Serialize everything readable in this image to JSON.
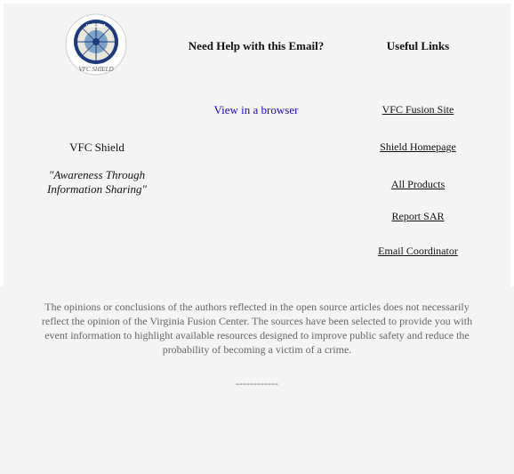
{
  "header": {
    "logo_text_top": "VIRGINIA",
    "logo_text_bottom": "VFC SHIELD",
    "logo_side_text": "FUSION CENTER",
    "help_heading": "Need Help with this Email?",
    "links_heading": "Useful Links"
  },
  "help": {
    "view_browser_label": "View in a browser"
  },
  "brand": {
    "name": "VFC Shield",
    "motto_line1": "\"Awareness Through",
    "motto_line2": "Information Sharing\""
  },
  "useful_links": [
    {
      "label": "VFC Fusion Site"
    },
    {
      "label": "Shield Homepage"
    },
    {
      "label": "All Products"
    },
    {
      "label": "Report SAR"
    },
    {
      "label": "Email Coordinator"
    }
  ],
  "footer": {
    "disclaimer": "The opinions or conclusions of the authors reflected in the open source articles does not necessarily reflect the opinion of the Virginia Fusion Center. The sources have been selected to provide you with event information to highlight available resources designed to improve public safety and reduce the probability of becoming a victim of a crime.",
    "divider": "------------"
  },
  "colors": {
    "panel_bg": "#f4f4f4",
    "link": "#1a0dab",
    "muted_text": "#666666"
  }
}
